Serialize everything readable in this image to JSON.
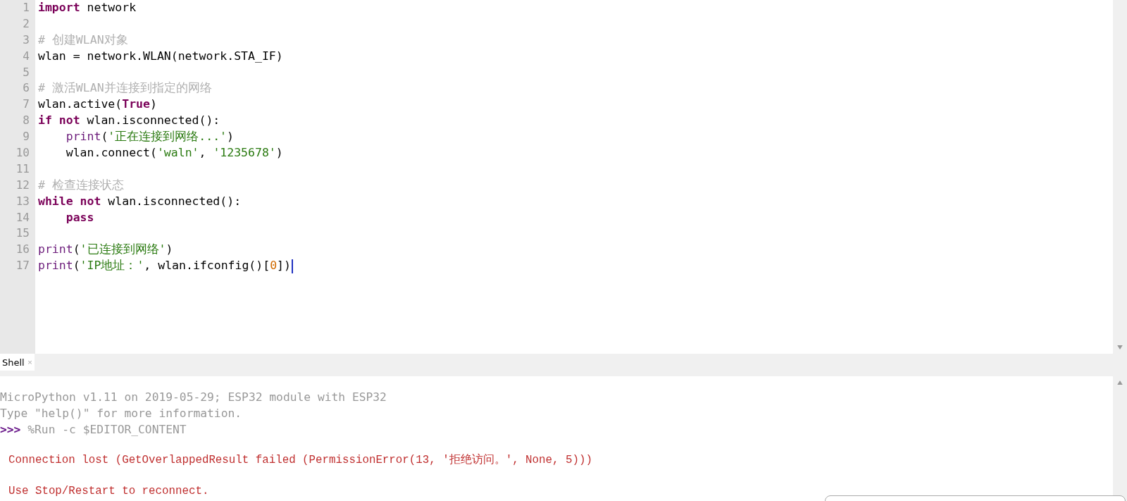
{
  "editor": {
    "lines": [
      {
        "number": "1",
        "cursor": false,
        "tokens": [
          {
            "kind": "keyword",
            "text": "import"
          },
          {
            "kind": "text",
            "text": " network"
          }
        ]
      },
      {
        "number": "2",
        "cursor": false
      },
      {
        "number": "3",
        "cursor": false,
        "tokens": [
          {
            "kind": "comment",
            "text": "# 创建WLAN对象"
          }
        ]
      },
      {
        "number": "4",
        "cursor": false,
        "tokens": [
          {
            "kind": "text",
            "text": "wlan = network.WLAN(network.STA_IF)"
          }
        ]
      },
      {
        "number": "5",
        "cursor": false
      },
      {
        "number": "6",
        "cursor": false,
        "tokens": [
          {
            "kind": "comment",
            "text": "# 激活WLAN并连接到指定的网络"
          }
        ]
      },
      {
        "number": "7",
        "cursor": false,
        "tokens": [
          {
            "kind": "text",
            "text": "wlan.active("
          },
          {
            "kind": "keyword",
            "text": "True"
          },
          {
            "kind": "text",
            "text": ")"
          }
        ]
      },
      {
        "number": "8",
        "cursor": false,
        "tokens": [
          {
            "kind": "keyword",
            "text": "if not"
          },
          {
            "kind": "text",
            "text": " wlan.isconnected():"
          }
        ]
      },
      {
        "number": "9",
        "cursor": false,
        "tokens": [
          {
            "kind": "builtin",
            "text": "    print"
          },
          {
            "kind": "text",
            "text": "("
          },
          {
            "kind": "string",
            "text": "'正在连接到网络...'"
          },
          {
            "kind": "text",
            "text": ")"
          }
        ]
      },
      {
        "number": "10",
        "cursor": false,
        "tokens": [
          {
            "kind": "text",
            "text": "    wlan.connect("
          },
          {
            "kind": "string",
            "text": "'waln'"
          },
          {
            "kind": "text",
            "text": ", "
          },
          {
            "kind": "string",
            "text": "'1235678'"
          },
          {
            "kind": "text",
            "text": ")"
          }
        ]
      },
      {
        "number": "11",
        "cursor": false
      },
      {
        "number": "12",
        "cursor": false,
        "tokens": [
          {
            "kind": "comment",
            "text": "# 检查连接状态"
          }
        ]
      },
      {
        "number": "13",
        "cursor": false,
        "tokens": [
          {
            "kind": "keyword",
            "text": "while not"
          },
          {
            "kind": "text",
            "text": " wlan.isconnected():"
          }
        ]
      },
      {
        "number": "14",
        "cursor": false,
        "tokens": [
          {
            "kind": "keyword",
            "text": "    pass"
          }
        ]
      },
      {
        "number": "15",
        "cursor": false
      },
      {
        "number": "16",
        "cursor": false,
        "tokens": [
          {
            "kind": "builtin",
            "text": "print"
          },
          {
            "kind": "text",
            "text": "("
          },
          {
            "kind": "string",
            "text": "'已连接到网络'"
          },
          {
            "kind": "text",
            "text": ")"
          }
        ]
      },
      {
        "number": "17",
        "cursor": true,
        "tokens": [
          {
            "kind": "builtin",
            "text": "print"
          },
          {
            "kind": "text",
            "text": "("
          },
          {
            "kind": "string",
            "text": "'IP地址：'"
          },
          {
            "kind": "text",
            "text": ", wlan.ifconfig()["
          },
          {
            "kind": "number",
            "text": "0"
          },
          {
            "kind": "text",
            "text": "])"
          }
        ]
      }
    ]
  },
  "shell_tab": {
    "label": "Shell",
    "close": "×",
    "selected": true
  },
  "shell": {
    "lines": [
      {
        "kind": "info",
        "text": "MicroPython v1.11 on 2019-05-29; ESP32 module with ESP32"
      },
      {
        "kind": "info",
        "text": "Type \"help()\" for more information."
      },
      {
        "kind": "prompt",
        "prompt": ">>>",
        "text": " %Run -c $EDITOR_CONTENT"
      },
      {
        "kind": "error",
        "text": "Connection lost (GetOverlappedResult failed (PermissionError(13, '拒绝访问。', None, 5)))"
      },
      {
        "kind": "error",
        "text": "Use Stop/Restart to reconnect."
      }
    ]
  }
}
